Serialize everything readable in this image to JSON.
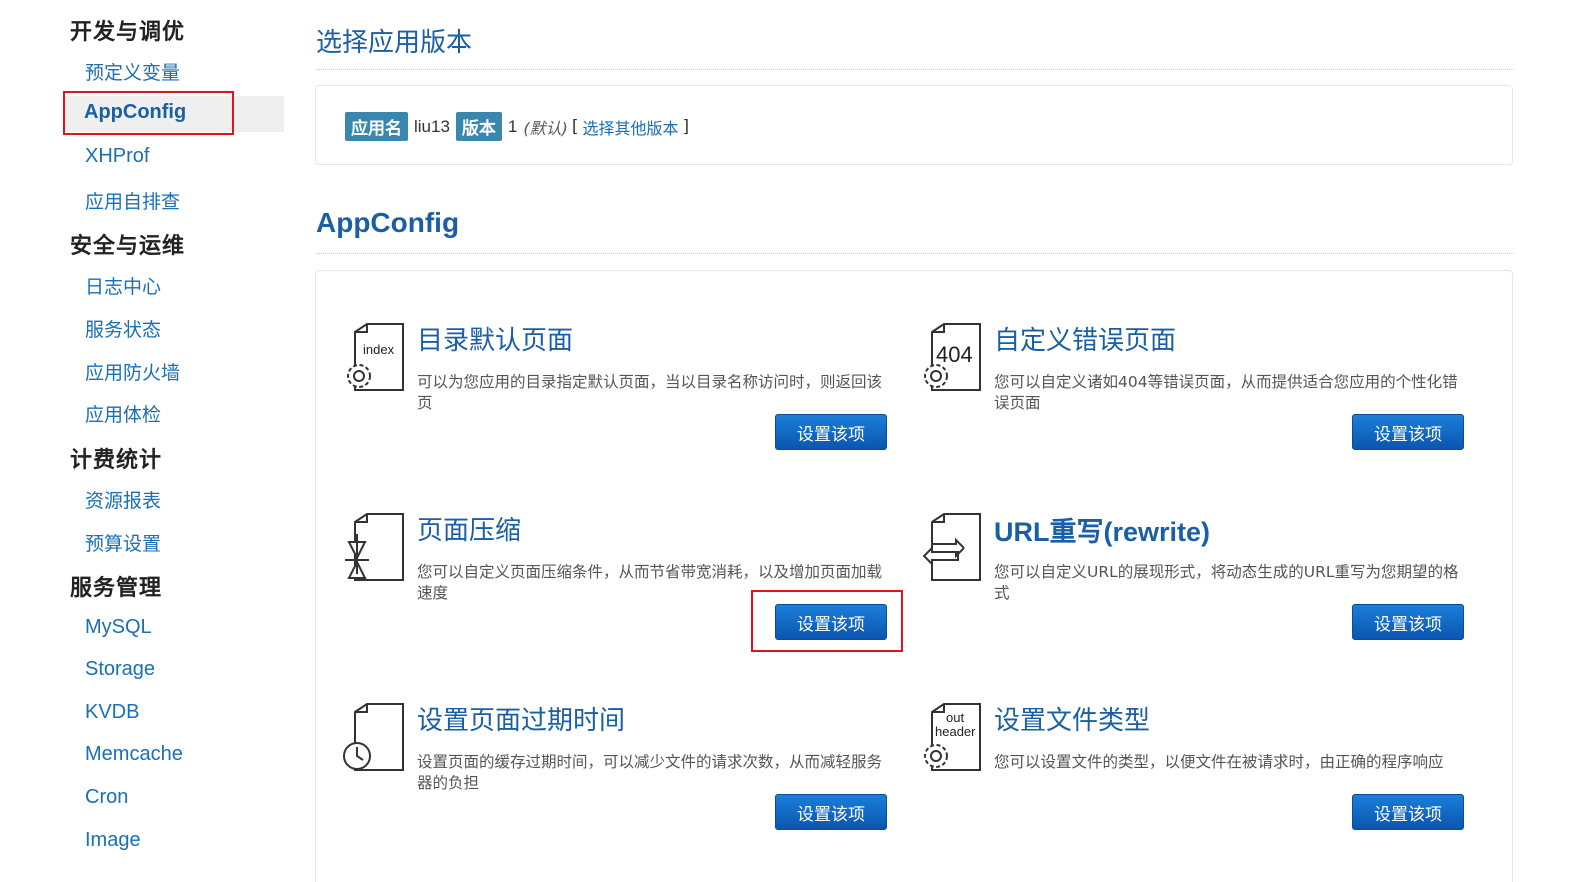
{
  "sidebar": {
    "sections": [
      {
        "title": "开发与调优",
        "items": [
          {
            "label": "预定义变量"
          },
          {
            "label": "AppConfig",
            "active": true
          },
          {
            "label": "XHProf"
          },
          {
            "label": "应用自排查"
          }
        ]
      },
      {
        "title": "安全与运维",
        "items": [
          {
            "label": "日志中心"
          },
          {
            "label": "服务状态"
          },
          {
            "label": "应用防火墙"
          },
          {
            "label": "应用体检"
          }
        ]
      },
      {
        "title": "计费统计",
        "items": [
          {
            "label": "资源报表"
          },
          {
            "label": "预算设置"
          }
        ]
      },
      {
        "title": "服务管理",
        "items": [
          {
            "label": "MySQL"
          },
          {
            "label": "Storage"
          },
          {
            "label": "KVDB"
          },
          {
            "label": "Memcache"
          },
          {
            "label": "Cron"
          },
          {
            "label": "Image"
          }
        ]
      }
    ]
  },
  "version_section": {
    "heading": "选择应用版本",
    "app_name_tag": "应用名",
    "app_name": "liu13",
    "version_tag": "版本",
    "version": "1",
    "default_note": "(默认)",
    "bracket_open": "[",
    "choose_link": "选择其他版本",
    "bracket_close": "]"
  },
  "appconfig": {
    "heading": "AppConfig",
    "features": [
      {
        "title": "目录默认页面",
        "icon": "index-page-icon",
        "icon_text": "index",
        "desc": "可以为您应用的目录指定默认页面，当以目录名称访问时，则返回该页",
        "button": "设置该项"
      },
      {
        "title": "自定义错误页面",
        "icon": "error-404-icon",
        "icon_text": "404",
        "desc": "您可以自定义诸如404等错误页面，从而提供适合您应用的个性化错误页面",
        "button": "设置该项"
      },
      {
        "title": "页面压缩",
        "icon": "compress-icon",
        "desc": "您可以自定义页面压缩条件，从而节省带宽消耗，以及增加页面加载速度",
        "button": "设置该项",
        "highlighted": true
      },
      {
        "title": "URL重写(rewrite)",
        "icon": "rewrite-icon",
        "desc": "您可以自定义URL的展现形式，将动态生成的URL重写为您期望的格式",
        "button": "设置该项"
      },
      {
        "title": "设置页面过期时间",
        "icon": "expire-clock-icon",
        "desc": "设置页面的缓存过期时间，可以减少文件的请求次数，从而减轻服务器的负担",
        "button": "设置该项"
      },
      {
        "title": "设置文件类型",
        "icon": "out-header-icon",
        "icon_text": "out header",
        "icon_text_line1": "out",
        "icon_text_line2": "header",
        "desc": "您可以设置文件的类型，以便文件在被请求时，由正确的程序响应",
        "button": "设置该项"
      }
    ]
  },
  "colors": {
    "link": "#1a6fb5",
    "heading": "#1a5fa5",
    "button": "#0b55b0",
    "tag": "#3a87ad",
    "highlight": "#e0141e"
  }
}
